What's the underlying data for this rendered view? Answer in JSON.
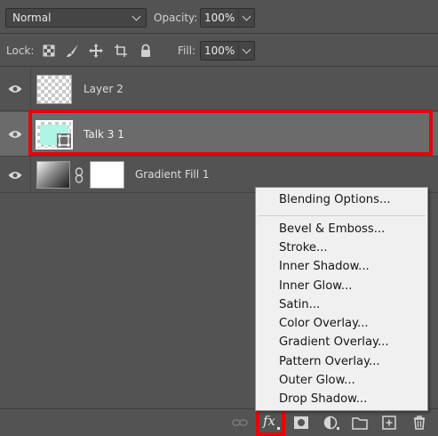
{
  "header": {
    "blend_mode": "Normal",
    "opacity_label": "Opacity:",
    "opacity_value": "100%",
    "lock_label": "Lock:",
    "fill_label": "Fill:",
    "fill_value": "100%"
  },
  "layers": [
    {
      "name": "Layer 2",
      "visible": true,
      "selected": false
    },
    {
      "name": "Talk 3 1",
      "visible": true,
      "selected": true
    },
    {
      "name": "Gradient Fill 1",
      "visible": true,
      "selected": false
    }
  ],
  "context_menu": {
    "items": [
      "Blending Options...",
      "Bevel & Emboss...",
      "Stroke...",
      "Inner Shadow...",
      "Inner Glow...",
      "Satin...",
      "Color Overlay...",
      "Gradient Overlay...",
      "Pattern Overlay...",
      "Outer Glow...",
      "Drop Shadow..."
    ]
  },
  "footer": {
    "fx_label": "fx",
    "icons": [
      "link-layers-icon",
      "fx-icon",
      "add-mask-icon",
      "adjustment-layer-icon",
      "group-folder-icon",
      "new-layer-icon",
      "trash-icon"
    ]
  },
  "colors": {
    "panel_bg": "#535353",
    "selected_row": "#6b6b6b",
    "highlight_red": "#e8000b",
    "menu_bg": "#f0f0f0",
    "thumb_mint": "#aef5e6"
  }
}
